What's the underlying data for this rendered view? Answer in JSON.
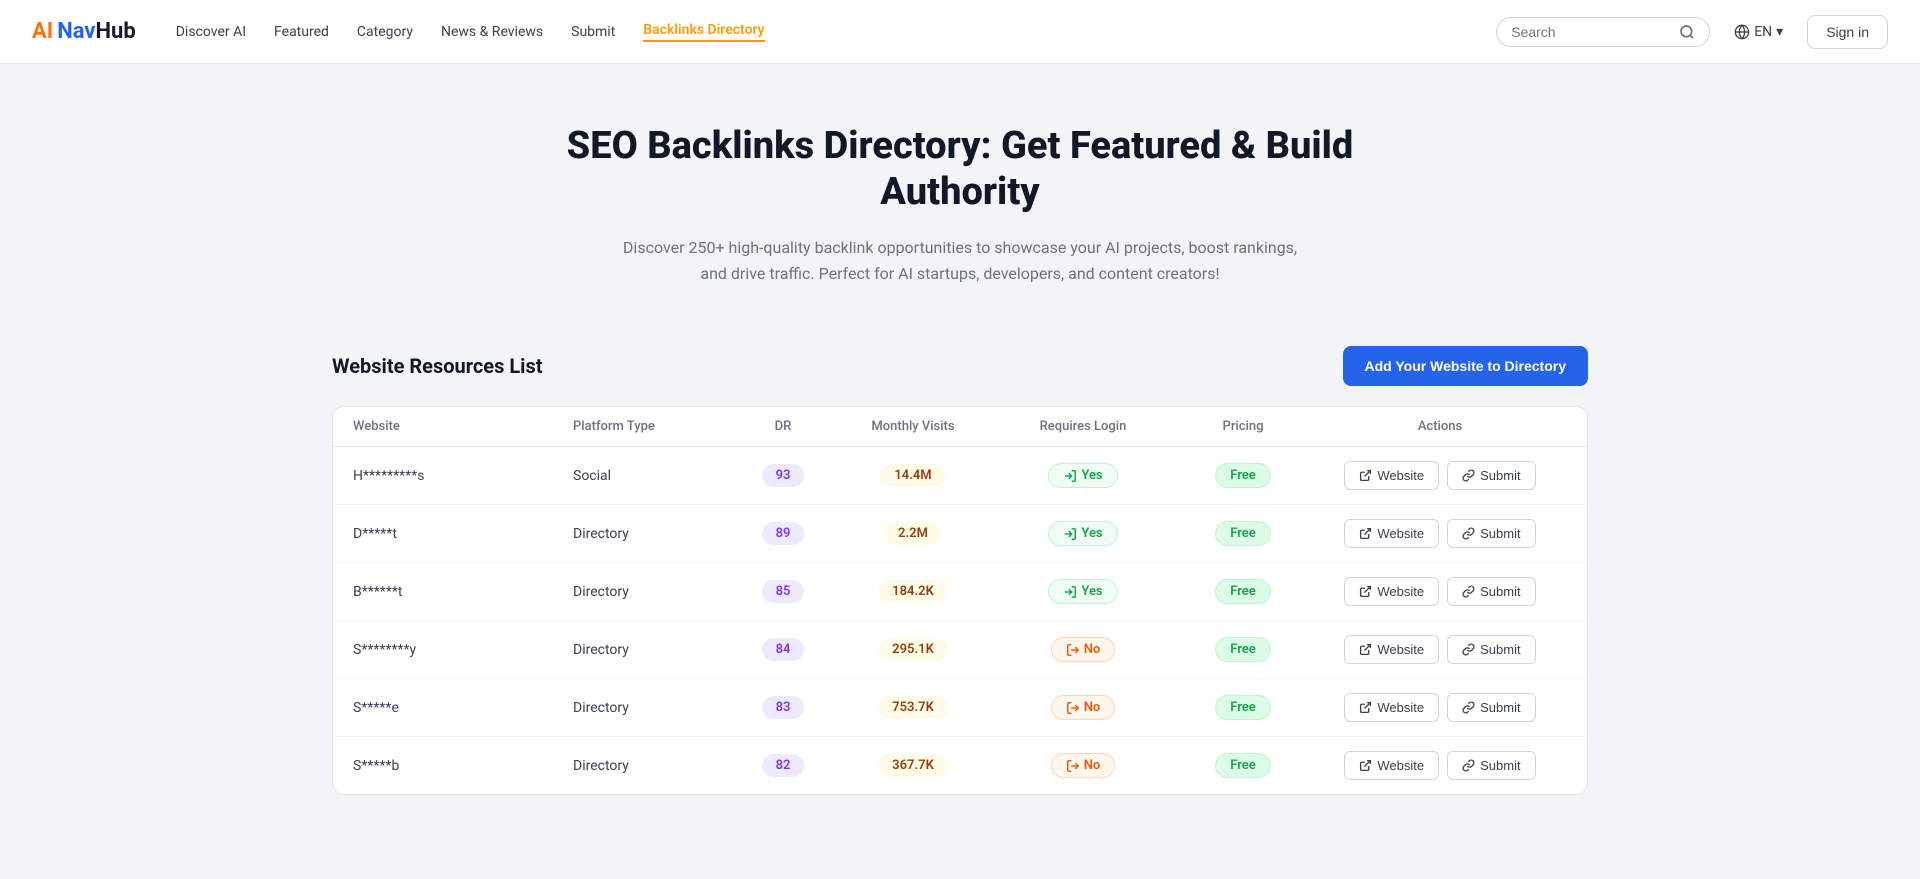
{
  "logo": {
    "ai": "AI",
    "nav": "Nav",
    "hub": "Hub"
  },
  "nav": {
    "links": [
      {
        "id": "discover-ai",
        "label": "Discover AI",
        "active": false
      },
      {
        "id": "featured",
        "label": "Featured",
        "active": false
      },
      {
        "id": "category",
        "label": "Category",
        "active": false
      },
      {
        "id": "news-reviews",
        "label": "News & Reviews",
        "active": false
      },
      {
        "id": "submit",
        "label": "Submit",
        "active": false
      },
      {
        "id": "backlinks-directory",
        "label": "Backlinks Directory",
        "active": true
      }
    ],
    "search_placeholder": "Search",
    "lang": "EN",
    "sign_in": "Sign in"
  },
  "hero": {
    "title": "SEO Backlinks Directory: Get Featured & Build Authority",
    "subtitle": "Discover 250+ high-quality backlink opportunities to showcase your AI projects, boost rankings, and drive traffic. Perfect for AI startups, developers, and content creators!"
  },
  "table_section": {
    "title": "Website Resources List",
    "add_button": "Add Your Website to Directory",
    "columns": [
      {
        "id": "website",
        "label": "Website"
      },
      {
        "id": "platform-type",
        "label": "Platform Type"
      },
      {
        "id": "dr",
        "label": "DR"
      },
      {
        "id": "monthly-visits",
        "label": "Monthly Visits"
      },
      {
        "id": "requires-login",
        "label": "Requires Login"
      },
      {
        "id": "pricing",
        "label": "Pricing"
      },
      {
        "id": "actions",
        "label": "Actions"
      }
    ],
    "rows": [
      {
        "website": "H*********s",
        "platform_type": "Social",
        "dr": "93",
        "monthly_visits": "14.4M",
        "requires_login": "Yes",
        "login_type": "yes",
        "pricing": "Free",
        "website_btn": "Website",
        "submit_btn": "Submit"
      },
      {
        "website": "D*****t",
        "platform_type": "Directory",
        "dr": "89",
        "monthly_visits": "2.2M",
        "requires_login": "Yes",
        "login_type": "yes",
        "pricing": "Free",
        "website_btn": "Website",
        "submit_btn": "Submit"
      },
      {
        "website": "B******t",
        "platform_type": "Directory",
        "dr": "85",
        "monthly_visits": "184.2K",
        "requires_login": "Yes",
        "login_type": "yes",
        "pricing": "Free",
        "website_btn": "Website",
        "submit_btn": "Submit"
      },
      {
        "website": "S********y",
        "platform_type": "Directory",
        "dr": "84",
        "monthly_visits": "295.1K",
        "requires_login": "No",
        "login_type": "no",
        "pricing": "Free",
        "website_btn": "Website",
        "submit_btn": "Submit"
      },
      {
        "website": "S*****e",
        "platform_type": "Directory",
        "dr": "83",
        "monthly_visits": "753.7K",
        "requires_login": "No",
        "login_type": "no",
        "pricing": "Free",
        "website_btn": "Website",
        "submit_btn": "Submit"
      },
      {
        "website": "S*****b",
        "platform_type": "Directory",
        "dr": "82",
        "monthly_visits": "367.7K",
        "requires_login": "No",
        "login_type": "no",
        "pricing": "Free",
        "website_btn": "Website",
        "submit_btn": "Submit"
      }
    ]
  },
  "icons": {
    "search": "🔍",
    "globe": "🌐",
    "chevron_down": "▾",
    "external_link": "↗",
    "link": "🔗",
    "login_yes": "→",
    "login_no": "→"
  }
}
